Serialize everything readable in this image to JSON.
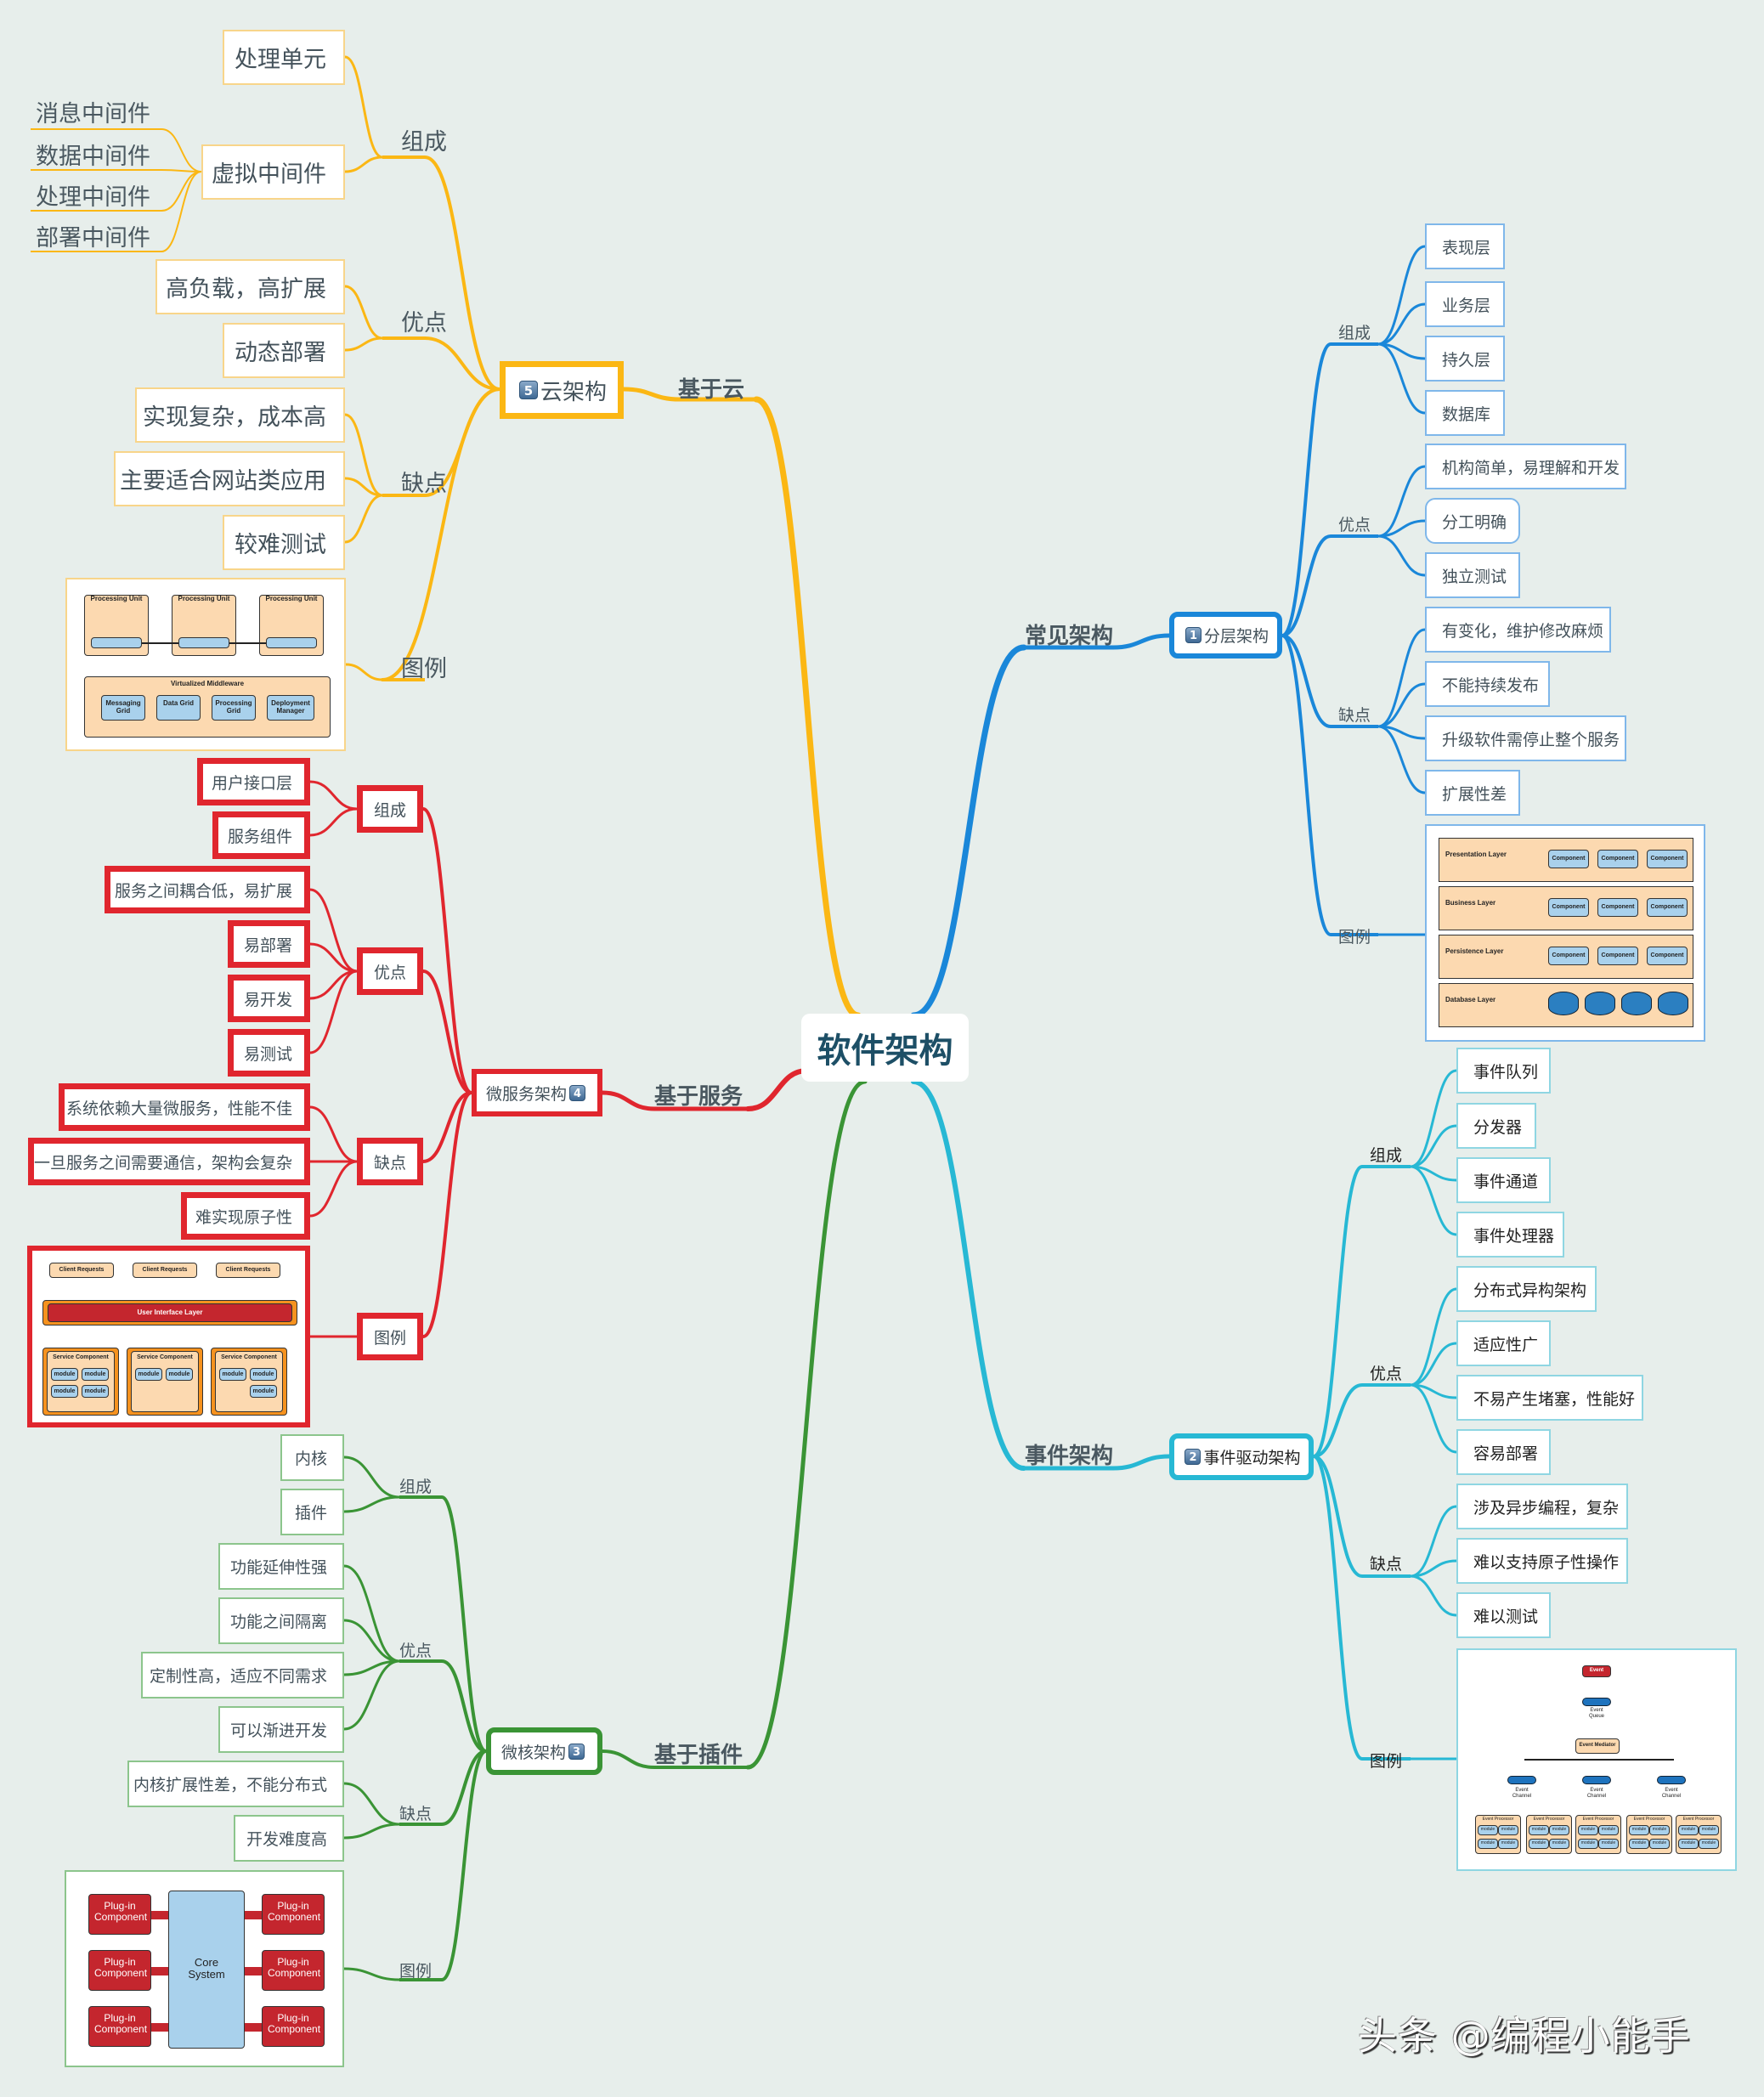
{
  "root": {
    "title": "软件架构"
  },
  "watermark": "头条 @编程小能手",
  "colors": {
    "background": "#e7eeeb",
    "cloud": "#fbb714",
    "layered": "#1a87d9",
    "microservice": "#e0262e",
    "microkernel": "#3a9435",
    "event": "#27b8d4",
    "root_text": "#1d4f66"
  },
  "branches": {
    "cloud": {
      "label": "基于云",
      "node": {
        "badge": "5",
        "title": "云架构"
      },
      "groups": {
        "composition": {
          "label": "组成",
          "items": [
            "处理单元",
            "虚拟中间件"
          ],
          "subitems": [
            "消息中间件",
            "数据中间件",
            "处理中间件",
            "部署中间件"
          ]
        },
        "pros": {
          "label": "优点",
          "items": [
            "高负载，高扩展",
            "动态部署"
          ]
        },
        "cons": {
          "label": "缺点",
          "items": [
            "实现复杂，成本高",
            "主要适合网站类应用",
            "较难测试"
          ]
        },
        "figure": {
          "label": "图例",
          "diagram": {
            "unit": "Processing Unit",
            "middleware": "Virtualized Middleware",
            "grids": [
              "Messaging Grid",
              "Data Grid",
              "Processing Grid",
              "Deployment Manager"
            ]
          }
        }
      }
    },
    "layered": {
      "label": "常见架构",
      "node": {
        "badge": "1",
        "title": "分层架构"
      },
      "groups": {
        "composition": {
          "label": "组成",
          "items": [
            "表现层",
            "业务层",
            "持久层",
            "数据库"
          ]
        },
        "pros": {
          "label": "优点",
          "items": [
            "机构简单，易理解和开发",
            "分工明确",
            "独立测试"
          ]
        },
        "cons": {
          "label": "缺点",
          "items": [
            "有变化，维护修改麻烦",
            "不能持续发布",
            "升级软件需停止整个服务",
            "扩展性差"
          ]
        },
        "figure": {
          "label": "图例",
          "diagram": {
            "layers": [
              "Presentation Layer",
              "Business Layer",
              "Persistence Layer",
              "Database Layer"
            ],
            "component": "Component"
          }
        }
      }
    },
    "microservice": {
      "label": "基于服务",
      "node": {
        "badge": "4",
        "title": "微服务架构"
      },
      "groups": {
        "composition": {
          "label": "组成",
          "items": [
            "用户接口层",
            "服务组件"
          ]
        },
        "pros": {
          "label": "优点",
          "items": [
            "服务之间耦合低，易扩展",
            "易部署",
            "易开发",
            "易测试"
          ]
        },
        "cons": {
          "label": "缺点",
          "items": [
            "系统依赖大量微服务，性能不佳",
            "一旦服务之间需要通信，架构会复杂",
            "难实现原子性"
          ]
        },
        "figure": {
          "label": "图例",
          "diagram": {
            "client": "Client Requests",
            "ui_layer": "User Interface Layer",
            "service": "Service Component",
            "module": "module"
          }
        }
      }
    },
    "microkernel": {
      "label": "基于插件",
      "node": {
        "badge": "3",
        "title": "微核架构"
      },
      "groups": {
        "composition": {
          "label": "组成",
          "items": [
            "内核",
            "插件"
          ]
        },
        "pros": {
          "label": "优点",
          "items": [
            "功能延伸性强",
            "功能之间隔离",
            "定制性高，适应不同需求",
            "可以渐进开发"
          ]
        },
        "cons": {
          "label": "缺点",
          "items": [
            "内核扩展性差，不能分布式",
            "开发难度高"
          ]
        },
        "figure": {
          "label": "图例",
          "diagram": {
            "core": "Core System",
            "plugin": "Plug-in Component"
          }
        }
      }
    },
    "event": {
      "label": "事件架构",
      "node": {
        "badge": "2",
        "title": "事件驱动架构"
      },
      "groups": {
        "composition": {
          "label": "组成",
          "items": [
            "事件队列",
            "分发器",
            "事件通道",
            "事件处理器"
          ]
        },
        "pros": {
          "label": "优点",
          "items": [
            "分布式异构架构",
            "适应性广",
            "不易产生堵塞，性能好",
            "容易部署"
          ]
        },
        "cons": {
          "label": "缺点",
          "items": [
            "涉及异步编程，复杂",
            "难以支持原子性操作",
            "难以测试"
          ]
        },
        "figure": {
          "label": "图例",
          "diagram": {
            "event": "Event",
            "queue": "Event Queue",
            "mediator": "Event Mediator",
            "channel": "Event Channel",
            "processor": "Event Processor",
            "module": "module"
          }
        }
      }
    }
  }
}
